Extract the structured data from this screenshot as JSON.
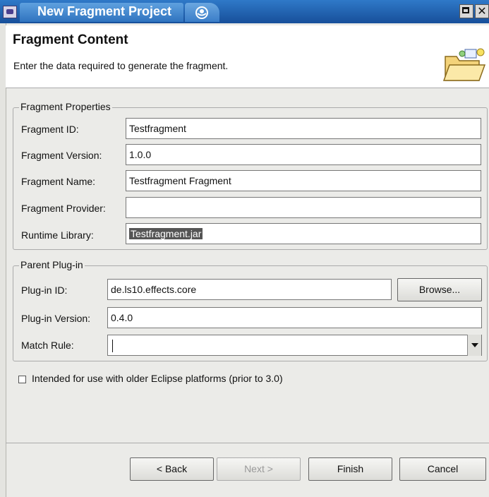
{
  "window": {
    "title": "New Fragment Project"
  },
  "header": {
    "title": "Fragment Content",
    "description": "Enter the data required to generate the fragment."
  },
  "fragment_properties": {
    "legend": "Fragment Properties",
    "id_label": "Fragment ID:",
    "id_value": "Testfragment",
    "version_label": "Fragment Version:",
    "version_value": "1.0.0",
    "name_label": "Fragment Name:",
    "name_value": "Testfragment Fragment",
    "provider_label": "Fragment Provider:",
    "provider_value": "",
    "library_label": "Runtime Library:",
    "library_value": "Testfragment.jar"
  },
  "parent_plugin": {
    "legend": "Parent Plug-in",
    "id_label": "Plug-in ID:",
    "id_value": "de.ls10.effects.core",
    "browse_label": "Browse...",
    "version_label": "Plug-in Version:",
    "version_value": "0.4.0",
    "match_label": "Match Rule:",
    "match_value": ""
  },
  "legacy_checkbox": {
    "label": "Intended for use with older Eclipse platforms (prior to 3.0)",
    "checked": false
  },
  "buttons": {
    "back": "< Back",
    "next": "Next >",
    "finish": "Finish",
    "cancel": "Cancel"
  }
}
